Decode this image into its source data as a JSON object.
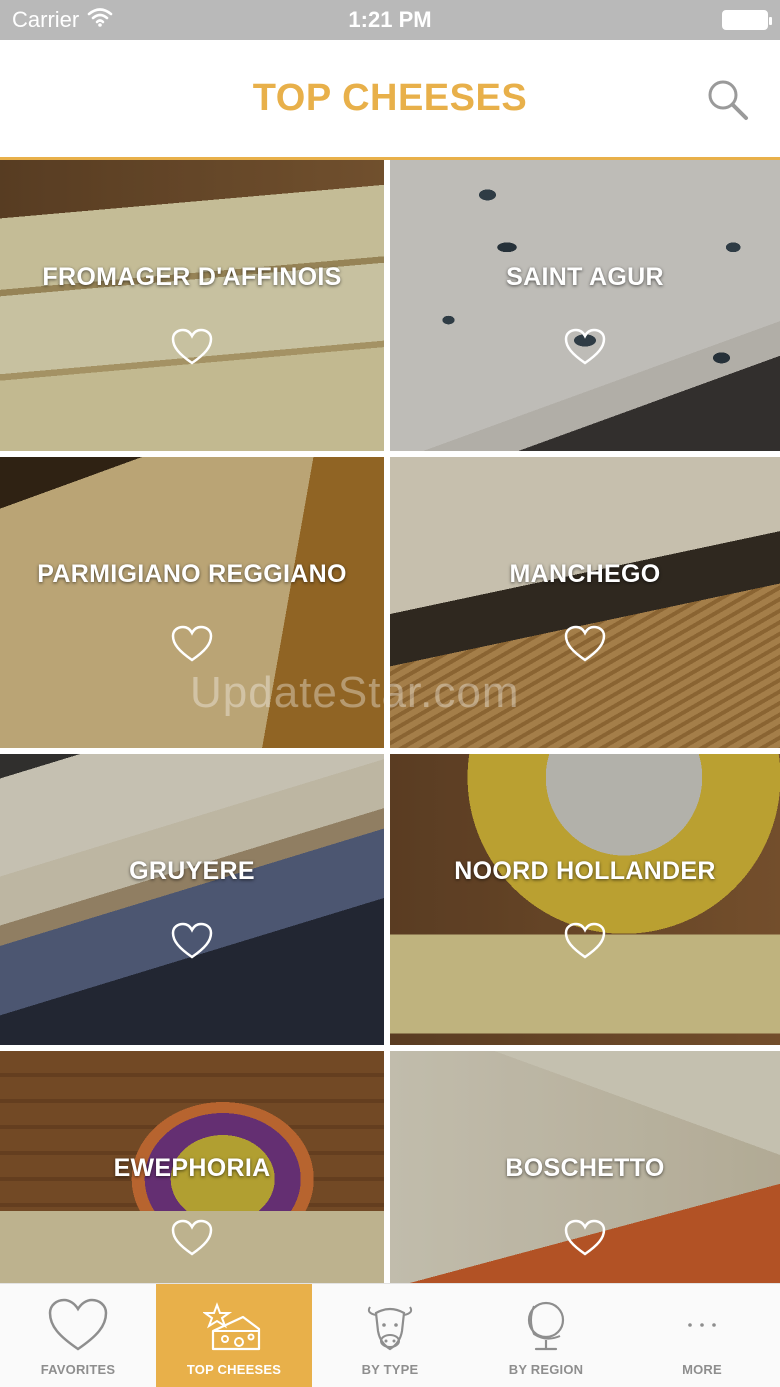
{
  "status": {
    "carrier": "Carrier",
    "time": "1:21 PM"
  },
  "header": {
    "title": "TOP CHEESES"
  },
  "cheeses": [
    {
      "name": "FROMAGER D'AFFINOIS"
    },
    {
      "name": "SAINT AGUR"
    },
    {
      "name": "PARMIGIANO REGGIANO"
    },
    {
      "name": "MANCHEGO"
    },
    {
      "name": "GRUYERE"
    },
    {
      "name": "NOORD HOLLANDER"
    },
    {
      "name": "EWEPHORIA"
    },
    {
      "name": "BOSCHETTO"
    }
  ],
  "watermark": "UpdateStar.com",
  "tabs": [
    {
      "label": "FAVORITES"
    },
    {
      "label": "TOP CHEESES"
    },
    {
      "label": "BY TYPE"
    },
    {
      "label": "BY REGION"
    },
    {
      "label": "MORE"
    }
  ],
  "colors": {
    "accent": "#e8b04a",
    "status_bar": "#b9b9b9",
    "tab_inactive": "#8e8e8e"
  },
  "icons": [
    "wifi-icon",
    "battery-icon",
    "search-icon",
    "heart-icon",
    "cheese-wedge-icon",
    "cow-icon",
    "globe-icon",
    "ellipsis-icon"
  ]
}
